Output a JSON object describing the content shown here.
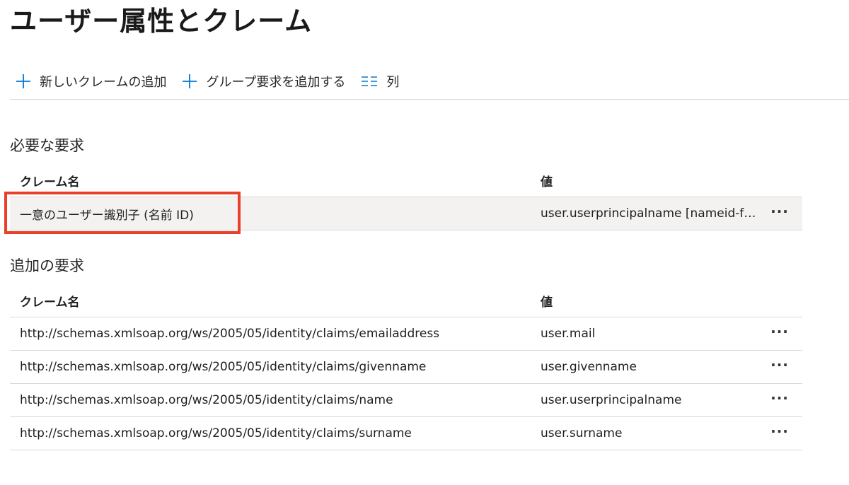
{
  "page": {
    "title": "ユーザー属性とクレーム"
  },
  "toolbar": {
    "add_claim": "新しいクレームの追加",
    "add_group_claim": "グループ要求を追加する",
    "columns": "列"
  },
  "required": {
    "title": "必要な要求",
    "headers": {
      "name": "クレーム名",
      "value": "値"
    },
    "rows": [
      {
        "name": "一意のユーザー識別子 (名前 ID)",
        "value": "user.userprincipalname [nameid-for..."
      }
    ]
  },
  "additional": {
    "title": "追加の要求",
    "headers": {
      "name": "クレーム名",
      "value": "値"
    },
    "rows": [
      {
        "name": "http://schemas.xmlsoap.org/ws/2005/05/identity/claims/emailaddress",
        "value": "user.mail"
      },
      {
        "name": "http://schemas.xmlsoap.org/ws/2005/05/identity/claims/givenname",
        "value": "user.givenname"
      },
      {
        "name": "http://schemas.xmlsoap.org/ws/2005/05/identity/claims/name",
        "value": "user.userprincipalname"
      },
      {
        "name": "http://schemas.xmlsoap.org/ws/2005/05/identity/claims/surname",
        "value": "user.surname"
      }
    ]
  },
  "more_label": "···",
  "colors": {
    "accent": "#0078d4",
    "highlight": "#e8402a"
  },
  "icons": {
    "add": "plus-icon",
    "columns": "columns-icon",
    "more": "more-icon"
  }
}
